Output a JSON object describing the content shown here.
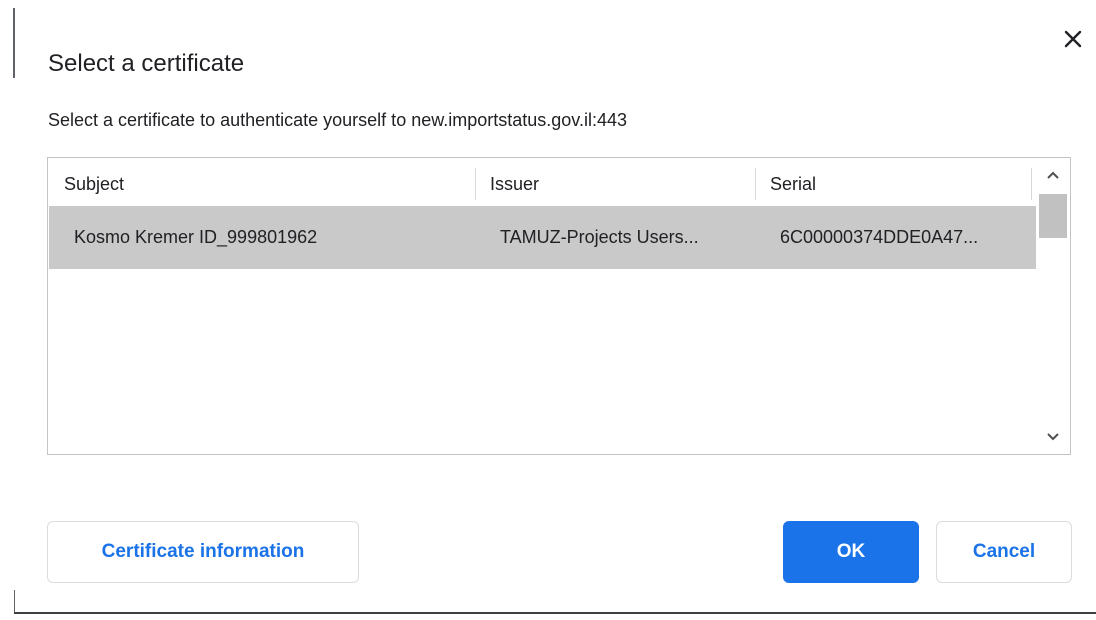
{
  "dialog": {
    "title": "Select a certificate",
    "subtitle": "Select a certificate to authenticate yourself to new.importstatus.gov.il:443",
    "close_icon": "close-icon"
  },
  "table": {
    "columns": [
      "Subject",
      "Issuer",
      "Serial"
    ],
    "rows": [
      {
        "subject": "Kosmo Kremer  ID_999801962",
        "issuer": "TAMUZ-Projects Users...",
        "serial": "6C00000374DDE0A47...",
        "selected": true
      }
    ],
    "scroll_up_icon": "chevron-up-icon",
    "scroll_down_icon": "chevron-down-icon"
  },
  "buttons": {
    "certificate_info": "Certificate information",
    "ok": "OK",
    "cancel": "Cancel"
  },
  "colors": {
    "accent": "#1a73e8",
    "selected_row": "#c9c9c9",
    "scroll_thumb": "#c1c1c1"
  }
}
